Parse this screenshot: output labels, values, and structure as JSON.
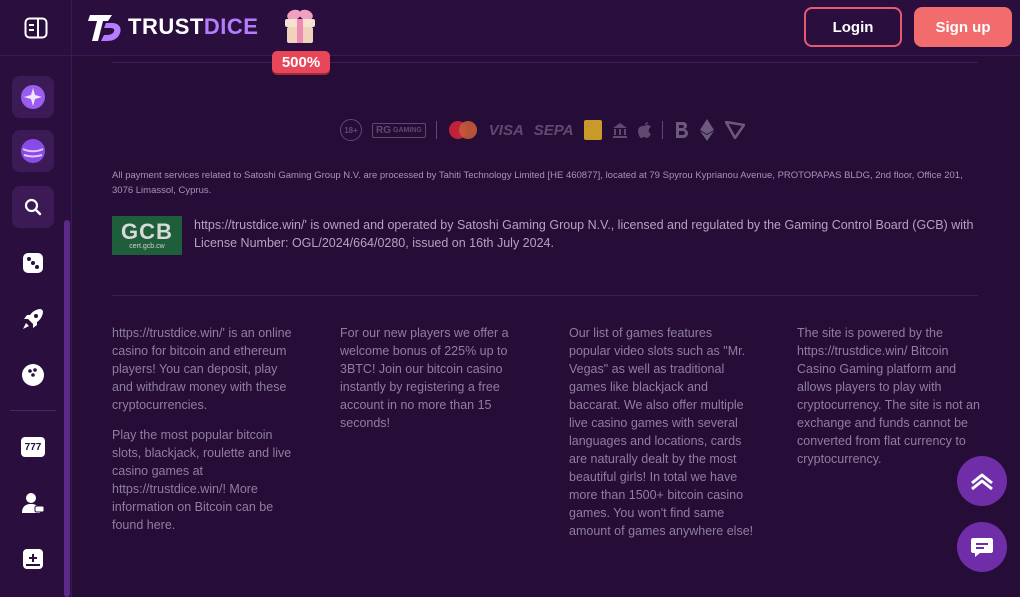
{
  "brand": {
    "name_part1": "TRUST",
    "name_part2": "DICE"
  },
  "promo": {
    "badge": "500%"
  },
  "auth": {
    "login_label": "Login",
    "signup_label": "Sign up"
  },
  "sidebar": {
    "items": [
      {
        "icon": "sparkle-orb-icon"
      },
      {
        "icon": "planet-orb-icon"
      },
      {
        "icon": "search-icon"
      },
      {
        "icon": "dice-icon"
      },
      {
        "icon": "rocket-icon"
      },
      {
        "icon": "bowling-ball-icon"
      },
      {
        "icon": "slots-777-icon",
        "label": "777"
      },
      {
        "icon": "live-dealer-icon"
      },
      {
        "icon": "add-game-icon"
      }
    ]
  },
  "payments": {
    "age_badge": "18+",
    "rg_label": "GAMING",
    "visa": "VISA",
    "sepa": "SEPA",
    "crypto": [
      "bitcoin-icon",
      "ethereum-icon",
      "tron-icon"
    ]
  },
  "footer": {
    "disclaimer": "All payment services related to Satoshi Gaming Group N.V. are processed by Tahiti Technology Limited [HE 460877], located at 79 Spyrou Kyprianou Avenue, PROTOPAPAS BLDG, 2nd floor, Office 201, 3076 Limassol, Cyprus.",
    "gcb": {
      "big": "GCB",
      "small": "cert.gcb.cw"
    },
    "license": "https://trustdice.win/' is owned and operated by Satoshi Gaming Group N.V., licensed and regulated by the Gaming Control Board (GCB) with License Number: OGL/2024/664/0280, issued on 16th July 2024.",
    "columns": [
      {
        "paragraphs": [
          "https://trustdice.win/' is an online casino for bitcoin and ethereum players! You can deposit, play and withdraw money with these cryptocurrencies.",
          "Play the most popular bitcoin slots, blackjack, roulette and live casino games at https://trustdice.win/! More information on Bitcoin can be found here."
        ]
      },
      {
        "paragraphs": [
          "For our new players we offer a welcome bonus of 225% up to 3BTC! Join our bitcoin casino instantly by registering a free account in no more than 15 seconds!"
        ]
      },
      {
        "paragraphs": [
          "Our list of games features popular video slots such as \"Mr. Vegas\" as well as traditional games like blackjack and baccarat. We also offer multiple live casino games with several languages and locations, cards are naturally dealt by the most beautiful girls! In total we have more than 1500+ bitcoin casino games. You won't find same amount of games anywhere else!"
        ]
      },
      {
        "paragraphs": [
          "The site is powered by the https://trustdice.win/ Bitcoin Casino Gaming platform and allows players to play with cryptocurrency. The site is not an exchange and funds cannot be converted from flat currency to cryptocurrency."
        ]
      }
    ]
  }
}
